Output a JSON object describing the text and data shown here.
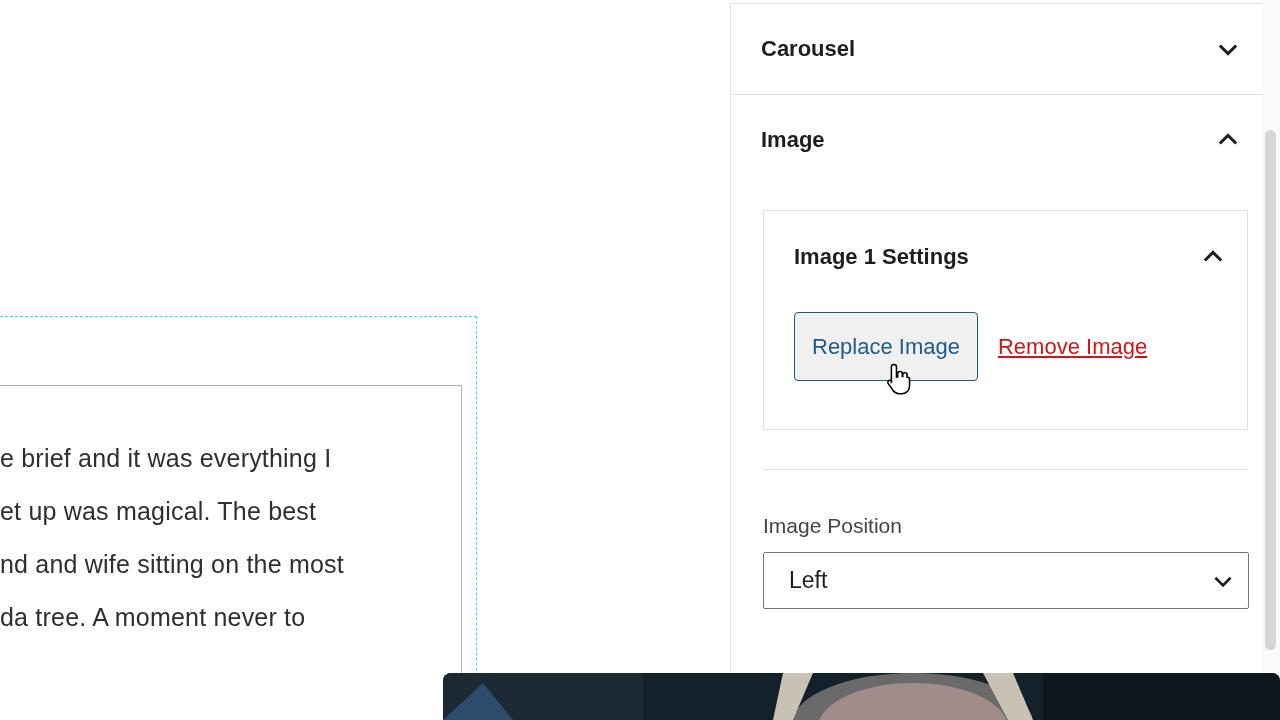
{
  "editor": {
    "paragraph_lines": [
      "e brief and it was everything I",
      "et up was magical. The best",
      "nd and wife sitting on the most",
      "da tree. A moment never to"
    ]
  },
  "sidebar": {
    "panels": [
      {
        "title": "Carousel",
        "expanded": false
      },
      {
        "title": "Image",
        "expanded": true
      }
    ],
    "image_settings": {
      "title": "Image 1 Settings",
      "expanded": true,
      "replace_button": "Replace Image",
      "remove_button": "Remove Image"
    },
    "image_position": {
      "label": "Image Position",
      "value": "Left"
    }
  }
}
